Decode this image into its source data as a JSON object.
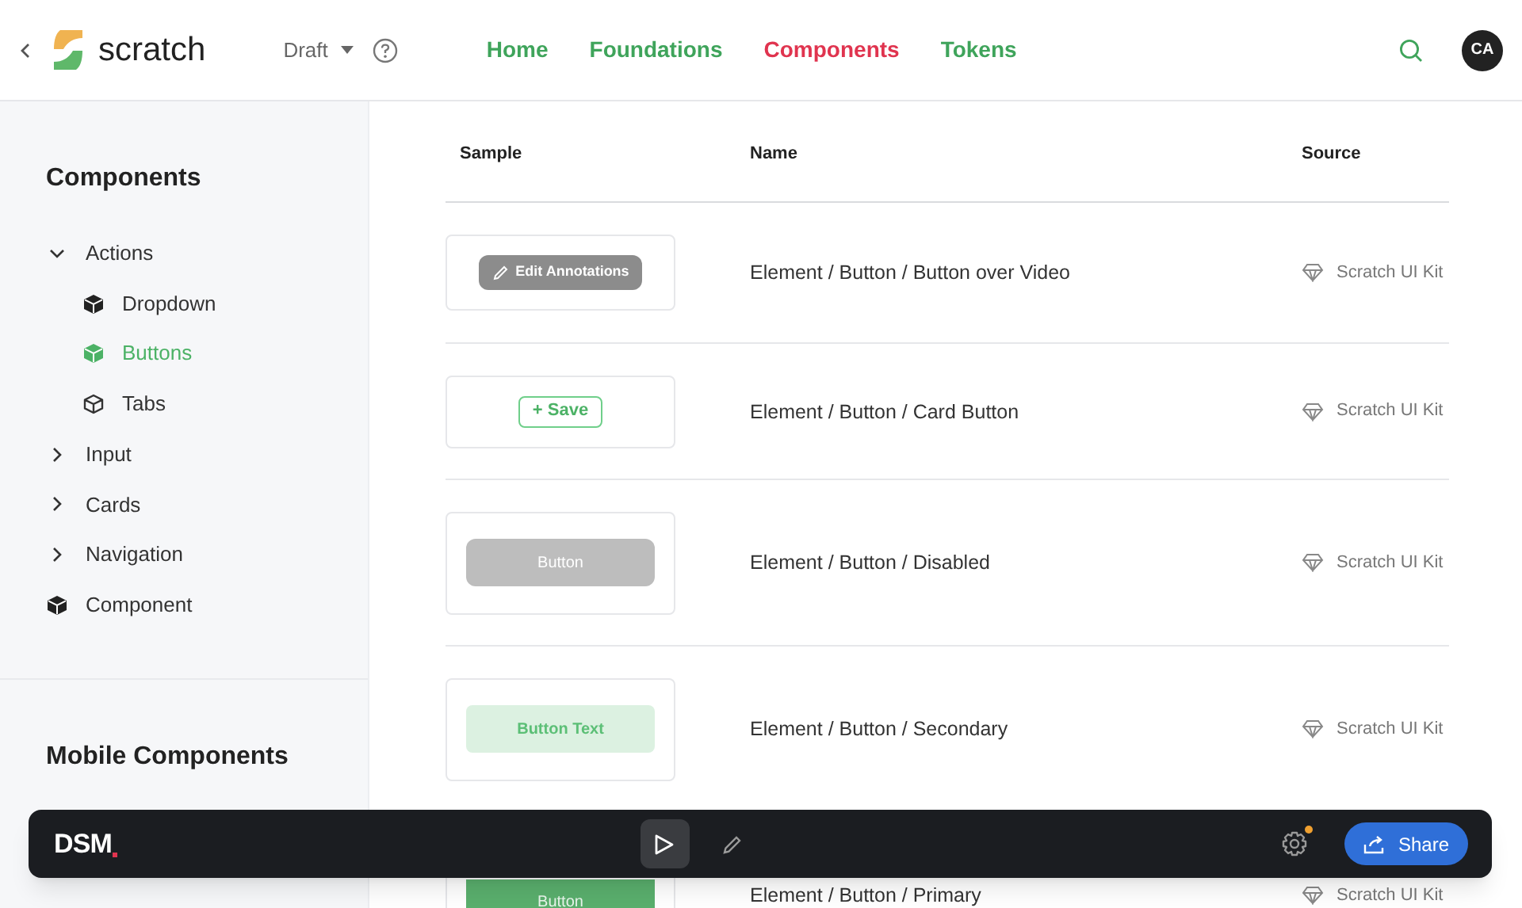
{
  "header": {
    "logo": "scratch",
    "version": "Draft",
    "nav": [
      {
        "label": "Home",
        "selected": false
      },
      {
        "label": "Foundations",
        "selected": false
      },
      {
        "label": "Components",
        "selected": true
      },
      {
        "label": "Tokens",
        "selected": false
      }
    ],
    "avatar": "CA"
  },
  "sidebar": {
    "sections": [
      {
        "title": "Components",
        "items": [
          {
            "label": "Actions",
            "kind": "group",
            "expanded": true,
            "selected": false,
            "children": [
              {
                "label": "Dropdown",
                "kind": "component",
                "selected": false
              },
              {
                "label": "Buttons",
                "kind": "component",
                "selected": true
              },
              {
                "label": "Tabs",
                "kind": "variant",
                "selected": false
              }
            ]
          },
          {
            "label": "Input",
            "kind": "group",
            "expanded": false,
            "selected": false
          },
          {
            "label": "Cards",
            "kind": "group",
            "expanded": false,
            "selected": false
          },
          {
            "label": "Navigation",
            "kind": "group",
            "expanded": false,
            "selected": false
          },
          {
            "label": "Component",
            "kind": "component",
            "selected": false
          }
        ]
      },
      {
        "title": "Mobile Components"
      }
    ]
  },
  "table": {
    "columns": [
      "Sample",
      "Name",
      "Source"
    ],
    "rows": [
      {
        "sample": {
          "kind": "overlay",
          "label": "Edit Annotations"
        },
        "name": "Element / Button / Button over Video",
        "source": "Scratch UI Kit"
      },
      {
        "sample": {
          "kind": "outline",
          "label": "+ Save"
        },
        "name": "Element / Button / Card Button",
        "source": "Scratch UI Kit"
      },
      {
        "sample": {
          "kind": "disabled",
          "label": "Button"
        },
        "name": "Element / Button / Disabled",
        "source": "Scratch UI Kit"
      },
      {
        "sample": {
          "kind": "secondary",
          "label": "Button Text"
        },
        "name": "Element / Button / Secondary",
        "source": "Scratch UI Kit"
      },
      {
        "sample": {
          "kind": "primary",
          "label": "Button"
        },
        "name": "Element / Button / Primary",
        "source": "Scratch UI Kit"
      }
    ]
  },
  "toolbar": {
    "logo": "DSM",
    "tools": [
      {
        "kind": "play",
        "selected": true
      },
      {
        "kind": "edit",
        "selected": false
      }
    ],
    "notification": true,
    "share": "Share"
  }
}
